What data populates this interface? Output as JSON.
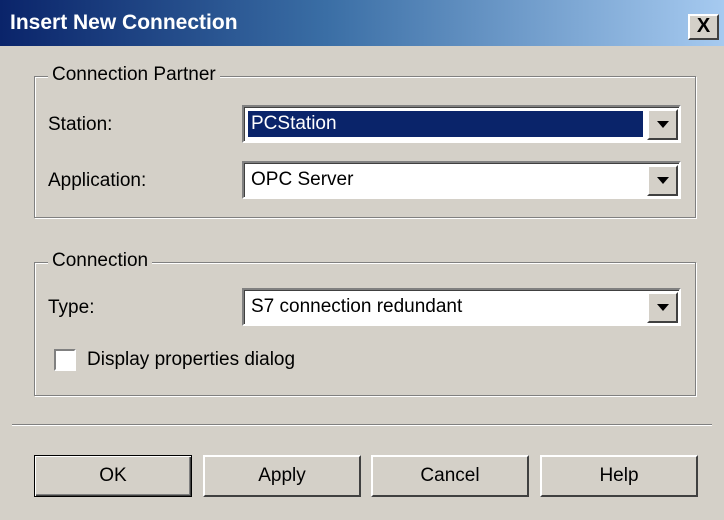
{
  "window": {
    "title": "Insert New Connection",
    "close_label": "X"
  },
  "connection_partner": {
    "group_label": "Connection Partner",
    "station_label": "Station:",
    "station_value": "PCStation",
    "application_label": "Application:",
    "application_value": "OPC Server"
  },
  "connection": {
    "group_label": "Connection",
    "type_label": "Type:",
    "type_value": "S7 connection redundant",
    "display_properties_label": "Display properties dialog",
    "display_properties_checked": false
  },
  "buttons": {
    "ok": "OK",
    "apply": "Apply",
    "cancel": "Cancel",
    "help": "Help"
  },
  "colors": {
    "title_start": "#0a246a",
    "title_end": "#a6caf0",
    "selection": "#0a246a",
    "face": "#d4d0c8"
  }
}
